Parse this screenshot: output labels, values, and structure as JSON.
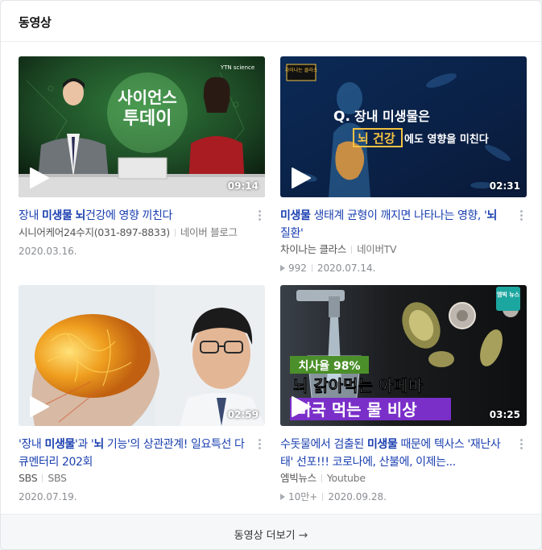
{
  "section": {
    "title": "동영상"
  },
  "videos": [
    {
      "title_parts": [
        "장내 ",
        "미생물",
        " ",
        "뇌",
        "건강에 영향 끼친다"
      ],
      "uploader": "시니어케어24수지(031-897-8833)",
      "platform": "네이버 블로그",
      "views": "",
      "date": "2020.03.16.",
      "duration": "09:14",
      "thumb_text": {
        "logo": "YTN science",
        "title1": "사이언스",
        "title2": "투데이"
      }
    },
    {
      "title_parts": [
        "",
        "미생물",
        " 생태계 균형이 깨지면 나타나는 영향, '",
        "뇌",
        " 질환'"
      ],
      "uploader": "차이나는 클라스",
      "platform": "네이버TV",
      "views": "992",
      "date": "2020.07.14.",
      "duration": "02:31",
      "thumb_text": {
        "badge": "차이나는 클라스",
        "q": "Q.",
        "line1": "장내 미생물은",
        "hl": "뇌 건강",
        "line2": "에도 영향을 미친다"
      }
    },
    {
      "title_parts": [
        "'장내 ",
        "미생물",
        "'과 '",
        "뇌",
        " 기능'의 상관관계! 일요특선 다큐멘터리 202회"
      ],
      "uploader": "SBS",
      "platform": "SBS",
      "views": "",
      "date": "2020.07.19.",
      "duration": "02:59",
      "thumb_text": {}
    },
    {
      "title_parts": [
        "수돗물에서 검출된 ",
        "미생물",
        " 때문에 텍사스 '재난사태' 선포!!! 코로나에, 산불에, 이제는..."
      ],
      "uploader": "엠빅뉴스",
      "platform": "Youtube",
      "views": "10만+",
      "date": "2020.09.28.",
      "duration": "03:25",
      "thumb_text": {
        "badge": "엠빅 뉴스",
        "rate": "치사율 98%",
        "line1": "뇌 갉아먹는 아메바",
        "line2": "미국 먹는 물 비상"
      }
    }
  ],
  "footer": {
    "more_label": "동영상 더보기",
    "arrow": "→"
  },
  "colors": {
    "link": "#1a3fb0",
    "text_muted": "#8a8d92",
    "footer_bg": "#f6f7f9"
  }
}
